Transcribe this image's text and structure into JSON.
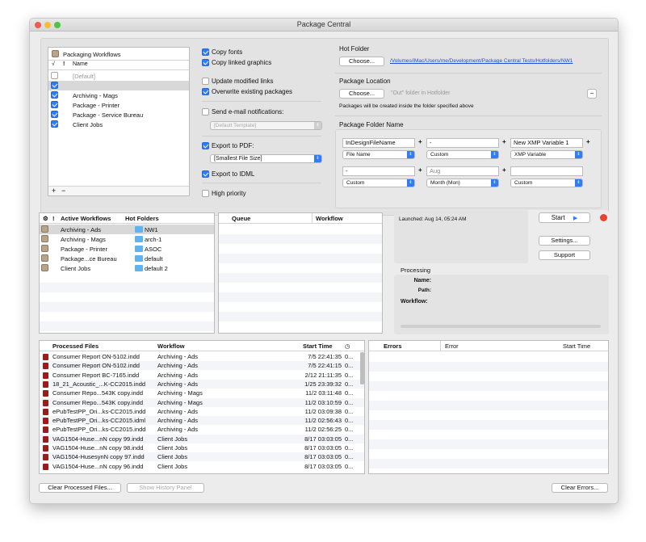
{
  "window": {
    "title": "Package Central"
  },
  "colors": {
    "accent": "#2f7cf6",
    "close": "#ee5b52",
    "minimize": "#f6bd3a",
    "zoom": "#4fc442",
    "file_icon": "#9c1c1c",
    "folder_icon": "#5fb3f0",
    "stop": "#e7432f"
  },
  "workflows_panel": {
    "title": "Packaging Workflows",
    "col_check": "√",
    "col_bang": "!",
    "col_name": "Name",
    "items": [
      {
        "name": "[Default]",
        "checked": false
      },
      {
        "name": "",
        "checked": true
      },
      {
        "name": "Archiving - Mags",
        "checked": true
      },
      {
        "name": "Package - Printer",
        "checked": true
      },
      {
        "name": "Package - Service Bureau",
        "checked": true
      },
      {
        "name": "Client Jobs",
        "checked": true
      }
    ],
    "add": "+",
    "remove": "−"
  },
  "options": {
    "copy_fonts": "Copy fonts",
    "copy_linked": "Copy linked graphics",
    "update_links": "Update modified links",
    "overwrite": "Overwrite existing packages",
    "send_email": "Send e-mail notifications:",
    "email_template": "[Default Template]",
    "export_pdf": "Export to PDF:",
    "pdf_preset": "[Smallest File Size]",
    "export_idml": "Export to IDML",
    "high_priority": "High priority"
  },
  "hot_folder": {
    "label": "Hot Folder",
    "choose": "Choose...",
    "path": "/Volumes/iMac/Users/me/Development/Package Central Tests/Hotfolders/NW1"
  },
  "package_location": {
    "label": "Package Location",
    "choose": "Choose...",
    "placeholder": "\"Out\" folder in Hotfolder",
    "remove": "−",
    "note": "Packages will be created inside the folder specified above"
  },
  "folder_name": {
    "label": "Package Folder Name",
    "row1": [
      {
        "value": "InDesignFileName",
        "popup": "File Name"
      },
      {
        "value": "-",
        "popup": "Custom"
      },
      {
        "value": "New XMP Variable 1",
        "popup": "XMP Variable"
      }
    ],
    "row2": [
      {
        "value": "-",
        "popup": "Custom"
      },
      {
        "value": "Aug",
        "popup": "Month (Mon)"
      },
      {
        "value": "",
        "popup": "Custom"
      }
    ],
    "plus": "+"
  },
  "active": {
    "col_icon": "⚙",
    "col_bang": "!",
    "col_workflows": "Active Workflows",
    "col_hot": "Hot Folders",
    "rows": [
      {
        "workflow": "Archiving - Ads",
        "folder": "NW1"
      },
      {
        "workflow": "Archiving - Mags",
        "folder": "arch-1"
      },
      {
        "workflow": "Package - Printer",
        "folder": "ASOC"
      },
      {
        "workflow": "Package...ce Bureau",
        "folder": "default"
      },
      {
        "workflow": "Client Jobs",
        "folder": "default 2"
      }
    ]
  },
  "queue": {
    "col_queue": "Queue",
    "col_workflow": "Workflow"
  },
  "status": {
    "launched": "Launched: Aug 14, 05:24 AM",
    "start": "Start",
    "settings": "Settings...",
    "support": "Support",
    "processing": "Processing",
    "name_label": "Name:",
    "path_label": "Path:",
    "workflow_label": "Workflow:",
    "progress": 0
  },
  "processed": {
    "col_files": "Processed Files",
    "col_workflow": "Workflow",
    "col_start": "Start Time",
    "rows": [
      {
        "file": "Consumer Report ON-5102.indd",
        "workflow": "Archiving - Ads",
        "time": "7/5 22:41:35",
        "extra": "0..."
      },
      {
        "file": "Consumer Report ON-5102.indd",
        "workflow": "Archiving - Ads",
        "time": "7/5 22:41:15",
        "extra": "0..."
      },
      {
        "file": "Consumer Report BC-7165.indd",
        "workflow": "Archiving - Ads",
        "time": "2/12 21:11:35",
        "extra": "0..."
      },
      {
        "file": "18_21_Acoustic_...K-CC2015.indd",
        "workflow": "Archiving - Ads",
        "time": "1/25 23:39:32",
        "extra": "0..."
      },
      {
        "file": "Consumer Repo...543K copy.indd",
        "workflow": "Archiving - Mags",
        "time": "11/2 03:11:48",
        "extra": "0..."
      },
      {
        "file": "Consumer Repo...543K copy.indd",
        "workflow": "Archiving - Mags",
        "time": "11/2 03:10:59",
        "extra": "0..."
      },
      {
        "file": "ePubTestPP_Ori...ks-CC2015.indd",
        "workflow": "Archiving - Ads",
        "time": "11/2 03:09:38",
        "extra": "0..."
      },
      {
        "file": "ePubTestPP_Ori...ks-CC2015.idml",
        "workflow": "Archiving - Ads",
        "time": "11/2 02:56:43",
        "extra": "0..."
      },
      {
        "file": "ePubTestPP_Ori...ks-CC2015.indd",
        "workflow": "Archiving - Ads",
        "time": "11/2 02:56:25",
        "extra": "0..."
      },
      {
        "file": "VAG1504-Huse...nN copy 99.indd",
        "workflow": "Client Jobs",
        "time": "8/17 03:03:05",
        "extra": "0..."
      },
      {
        "file": "VAG1504-Huse...nN copy 98.indd",
        "workflow": "Client Jobs",
        "time": "8/17 03:03:05",
        "extra": "0..."
      },
      {
        "file": "VAG1504-HusesynN copy 97.indd",
        "workflow": "Client Jobs",
        "time": "8/17 03:03:05",
        "extra": "0..."
      },
      {
        "file": "VAG1504-Huse...nN copy 96.indd",
        "workflow": "Client Jobs",
        "time": "8/17 03:03:05",
        "extra": "0..."
      }
    ]
  },
  "errors": {
    "col_errors": "Errors",
    "col_error": "Error",
    "col_start": "Start Time"
  },
  "buttons": {
    "clear_processed": "Clear Processed Files...",
    "show_history": "Show History Panel",
    "clear_errors": "Clear Errors..."
  }
}
